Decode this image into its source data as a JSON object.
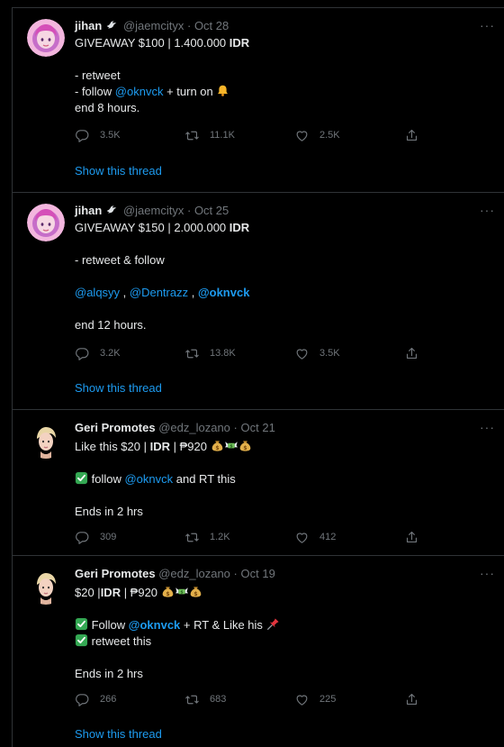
{
  "tweets": [
    {
      "name": "jihan",
      "handle": "@jaemcityx",
      "dot": "·",
      "date": "Oct 28",
      "more": "···",
      "line1_pre": "GIVEAWAY $100 | 1.400.000 ",
      "line1_bold": "IDR",
      "line2": "- retweet",
      "line3_pre": "- follow ",
      "line3_mention": "@oknvck",
      "line3_post": " + turn on ",
      "line4": "end 8 hours.",
      "replies": "3.5K",
      "retweets": "11.1K",
      "likes": "2.5K",
      "show_thread": "Show this thread"
    },
    {
      "name": "jihan",
      "handle": "@jaemcityx",
      "dot": "·",
      "date": "Oct 25",
      "more": "···",
      "line1_pre": "GIVEAWAY $150 | 2.000.000 ",
      "line1_bold": "IDR",
      "line2": "- retweet & follow",
      "mention_a": "@alqsyy",
      "sep_a": " , ",
      "mention_b": "@Dentrazz",
      "sep_b": " , ",
      "mention_c": "@oknvck",
      "line4": "end 12 hours.",
      "replies": "3.2K",
      "retweets": "13.8K",
      "likes": "3.5K",
      "show_thread": "Show this thread"
    },
    {
      "name": "Geri Promotes",
      "handle": "@edz_lozano",
      "dot": "·",
      "date": "Oct 21",
      "more": "···",
      "line1_pre": "Like this $20 | ",
      "line1_bold": "IDR",
      "line1_post": " | ₱920 ",
      "line2_pre": " follow ",
      "line2_mention": "@oknvck",
      "line2_post": " and RT this",
      "line3": "Ends in 2 hrs",
      "replies": "309",
      "retweets": "1.2K",
      "likes": "412"
    },
    {
      "name": "Geri Promotes",
      "handle": "@edz_lozano",
      "dot": "·",
      "date": "Oct 19",
      "more": "···",
      "line1_pre": "$20 |",
      "line1_bold": "IDR",
      "line1_post": " | ₱920 ",
      "line2_pre": " Follow ",
      "line2_mention": "@oknvck",
      "line2_post": "  + RT & Like his ",
      "line3": " retweet this",
      "line4": "Ends in 2 hrs",
      "replies": "266",
      "retweets": "683",
      "likes": "225",
      "show_thread": "Show this thread"
    }
  ],
  "icons": {
    "reply": "reply-icon",
    "retweet": "retweet-icon",
    "like": "heart-icon",
    "share": "share-icon",
    "bell": "bell-emoji-icon",
    "money_bag": "money-bag-emoji-icon",
    "money_wings": "money-with-wings-emoji-icon",
    "check": "check-mark-emoji-icon",
    "pin": "pushpin-emoji-icon",
    "badge": "dove-emoji-icon"
  },
  "colors": {
    "background": "#000000",
    "text": "#e7e9ea",
    "muted": "#71767b",
    "link": "#1d9bf0",
    "divider": "#2f3336"
  }
}
